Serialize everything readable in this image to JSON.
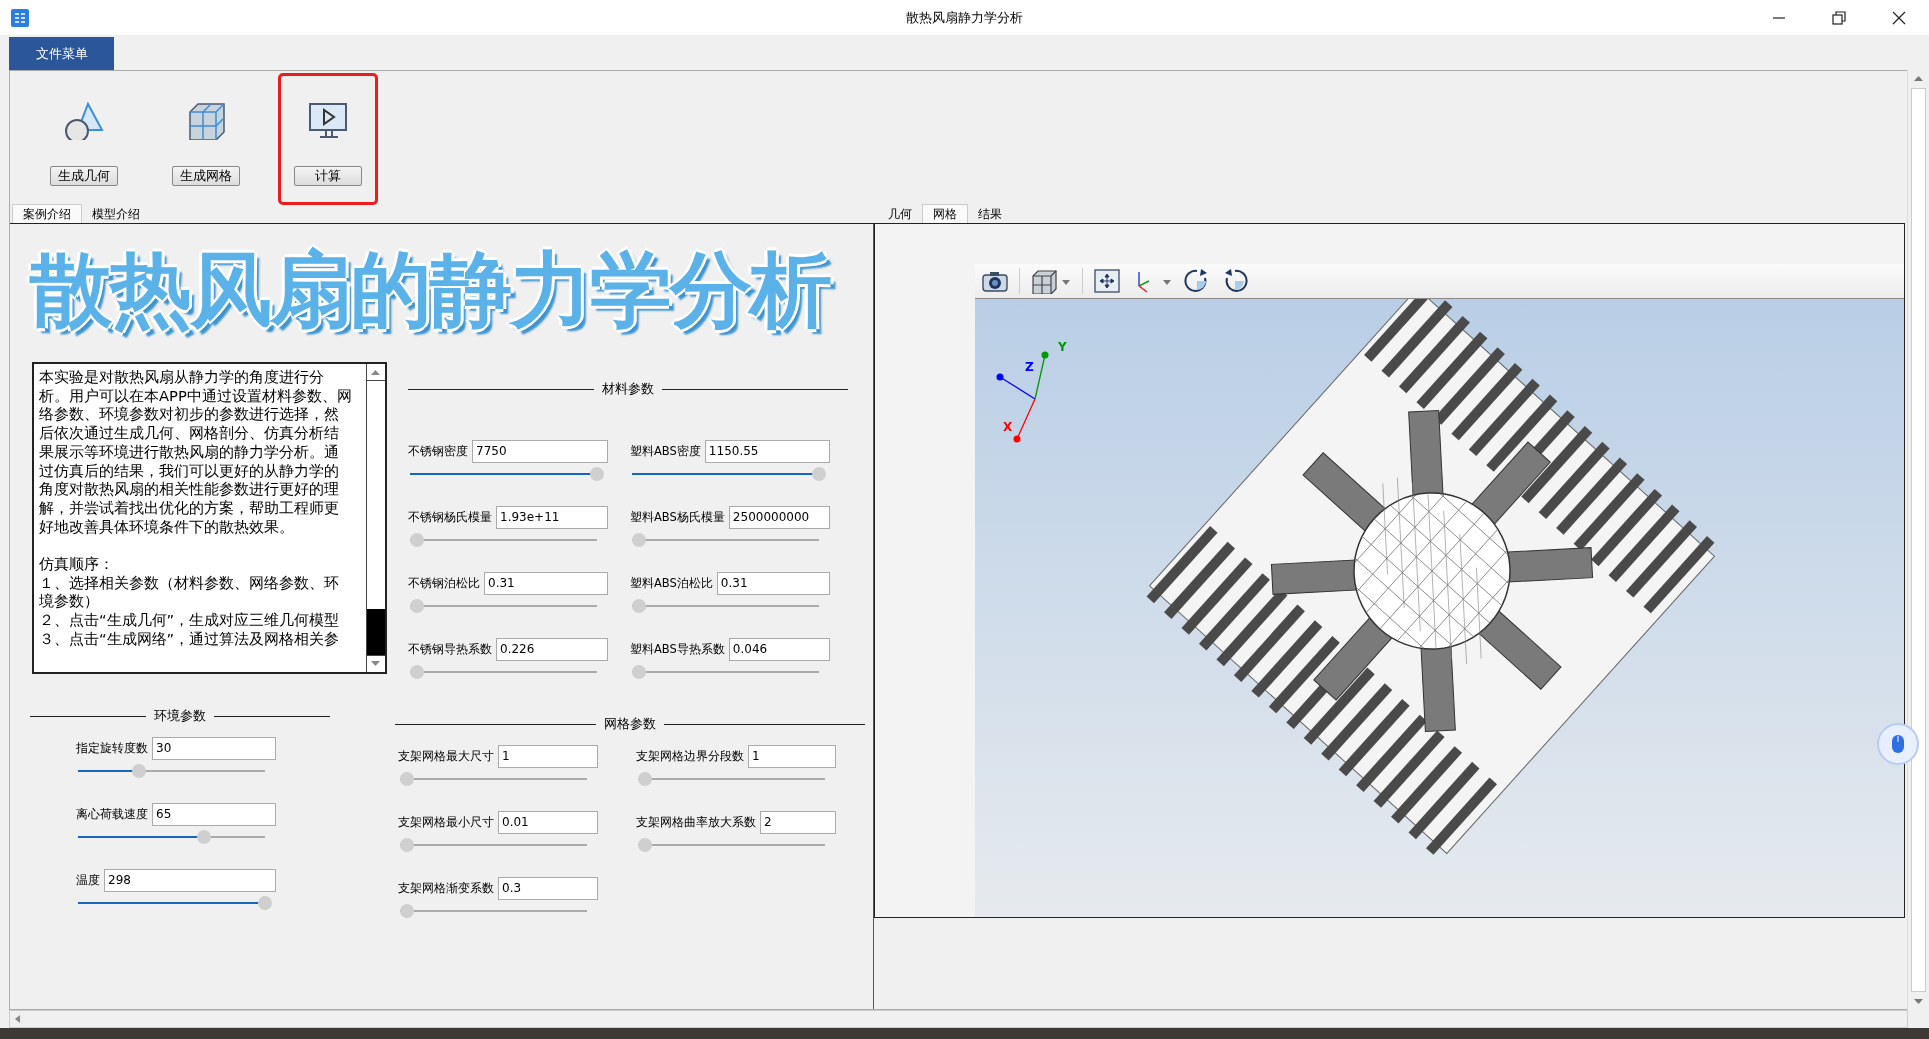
{
  "window": {
    "title": "散热风扇静力学分析"
  },
  "menu": [
    {
      "label": "文件菜单",
      "selected": true
    }
  ],
  "toolbar": [
    {
      "label": "生成几何",
      "kind": "geometry",
      "highlighted": false
    },
    {
      "label": "生成网格",
      "kind": "mesh",
      "highlighted": false
    },
    {
      "label": "计算",
      "kind": "compute",
      "highlighted": true
    }
  ],
  "left_tabs": [
    {
      "label": "案例介绍",
      "selected": true
    },
    {
      "label": "模型介绍",
      "selected": false
    }
  ],
  "banner": "散热风扇的静力学分析",
  "description": {
    "intro": "本实验是对散热风扇从静力学的角度进行分析。用户可以在本APP中通过设置材料参数、网络参数、环境参数对初步的参数进行选择，然后依次通过生成几何、网格剖分、仿真分析结果展示等环境进行散热风扇的静力学分析。通过仿真后的结果，我们可以更好的从静力学的角度对散热风扇的相关性能参数进行更好的理解，并尝试着找出优化的方案，帮助工程师更好地改善具体环境条件下的散热效果。",
    "steps_title": "仿真顺序：",
    "steps": [
      "１、选择相关参数（材料参数、网络参数、环境参数）",
      "２、点击“生成几何”，生成对应三维几何模型",
      "３、点击“生成网络”，通过算法及网格相关参"
    ]
  },
  "material": {
    "title": "材料参数",
    "params": [
      {
        "label": "不锈钢密度",
        "value": "7750",
        "level": 1
      },
      {
        "label": "塑料ABS密度",
        "value": "1150.55",
        "level": 1
      },
      {
        "label": "不锈钢杨氏模量",
        "value": "1.93e+11",
        "level": 0
      },
      {
        "label": "塑料ABS杨氏模量",
        "value": "2500000000",
        "level": 0
      },
      {
        "label": "不锈钢泊松比",
        "value": "0.31",
        "level": 0
      },
      {
        "label": "塑料ABS泊松比",
        "value": "0.31",
        "level": 0
      },
      {
        "label": "不锈钢导热系数",
        "value": "0.226",
        "level": 0
      },
      {
        "label": "塑料ABS导热系数",
        "value": "0.046",
        "level": 0
      }
    ]
  },
  "environment": {
    "title": "环境参数",
    "params": [
      {
        "label": "指定旋转度数",
        "value": "30",
        "level": 0.3
      },
      {
        "label": "离心荷载速度",
        "value": "65",
        "level": 0.66
      },
      {
        "label": "温度",
        "value": "298",
        "level": 1
      }
    ]
  },
  "mesh_params": {
    "title": "网格参数",
    "params": [
      {
        "label": "支架网格最大尺寸",
        "value": "1",
        "level": 0
      },
      {
        "label": "支架网格边界分段数",
        "value": "1",
        "level": 0
      },
      {
        "label": "支架网格最小尺寸",
        "value": "0.01",
        "level": 0
      },
      {
        "label": "支架网格曲率放大系数",
        "value": "2",
        "level": 0
      },
      {
        "label": "支架网格渐变系数",
        "value": "0.3",
        "level": 0
      }
    ]
  },
  "right_tabs": [
    {
      "label": "几何",
      "selected": false
    },
    {
      "label": "网格",
      "selected": true
    },
    {
      "label": "结果",
      "selected": false
    }
  ],
  "viewer": {
    "axes": [
      {
        "label": "Z",
        "color": "#0000ff"
      },
      {
        "label": "Y",
        "color": "#009a00"
      },
      {
        "label": "X",
        "color": "#ff0000"
      }
    ]
  }
}
